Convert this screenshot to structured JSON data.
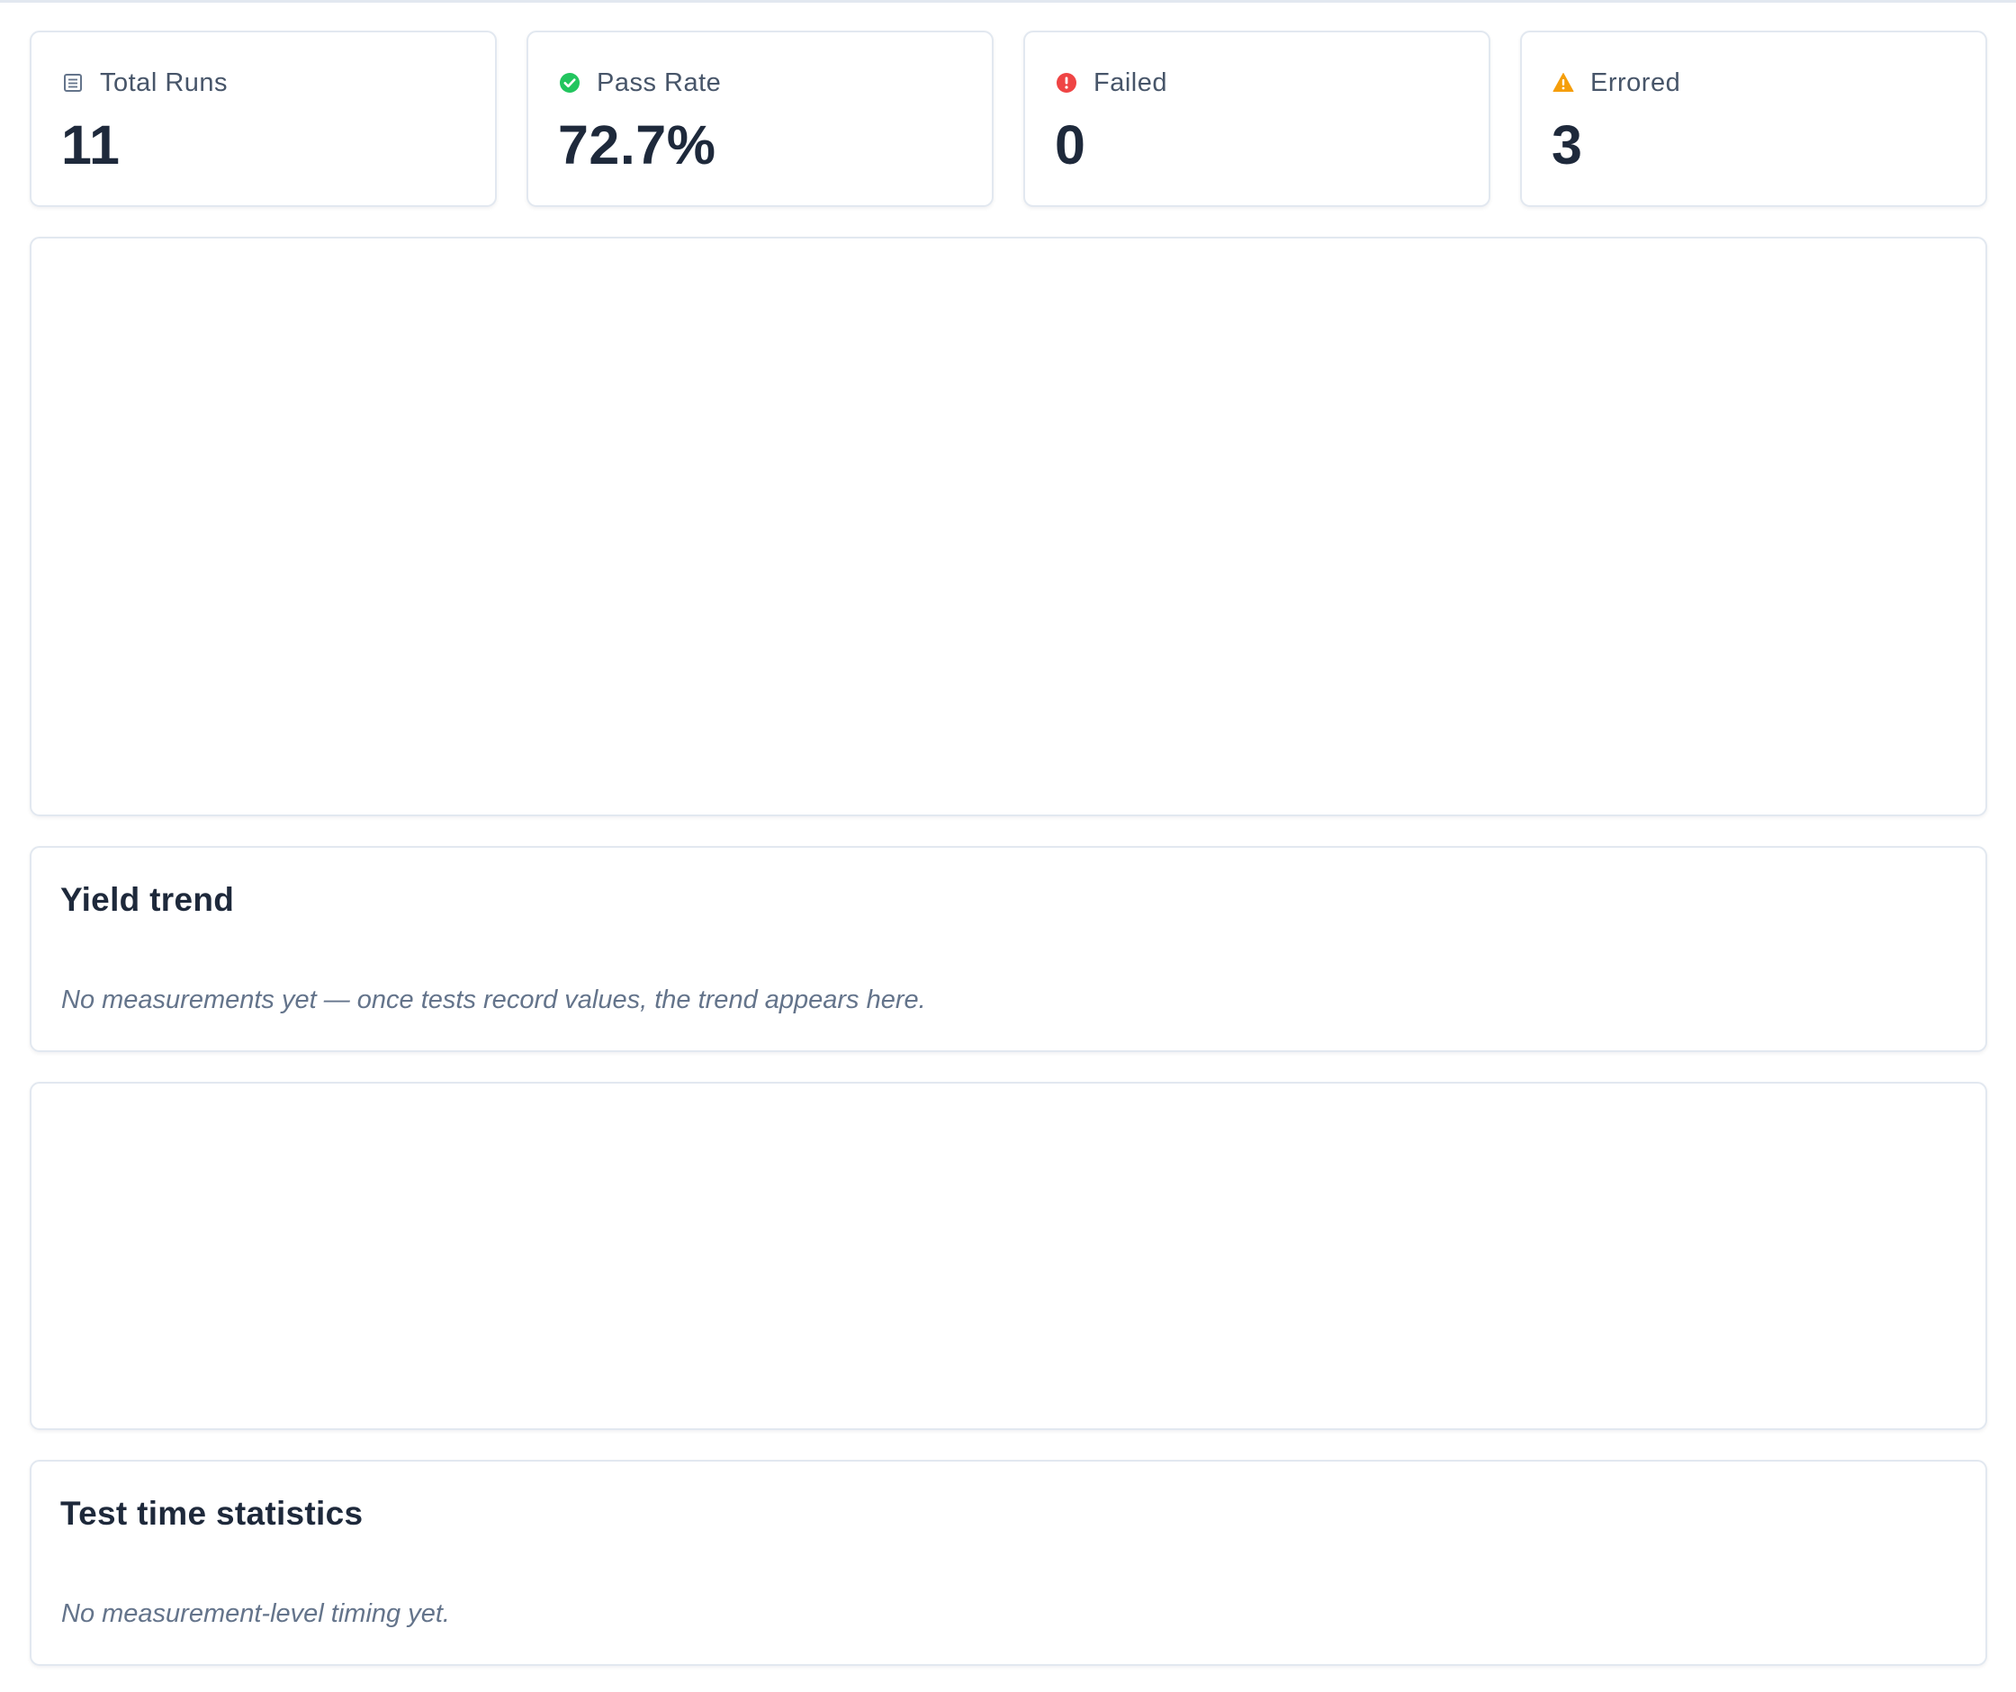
{
  "stats": [
    {
      "label": "Total Runs",
      "value": "11",
      "icon": "list-icon",
      "color": "#64748b"
    },
    {
      "label": "Pass Rate",
      "value": "72.7%",
      "icon": "check-circle-icon",
      "color": "#22c55e"
    },
    {
      "label": "Failed",
      "value": "0",
      "icon": "alert-circle-icon",
      "color": "#ef4444"
    },
    {
      "label": "Errored",
      "value": "3",
      "icon": "warning-triangle-icon",
      "color": "#f59e0b"
    }
  ],
  "yield_trend": {
    "title": "Yield trend",
    "empty_message": "No measurements yet — once tests record values, the trend appears here."
  },
  "test_time_statistics": {
    "title": "Test time statistics",
    "empty_message": "No measurement-level timing yet."
  }
}
